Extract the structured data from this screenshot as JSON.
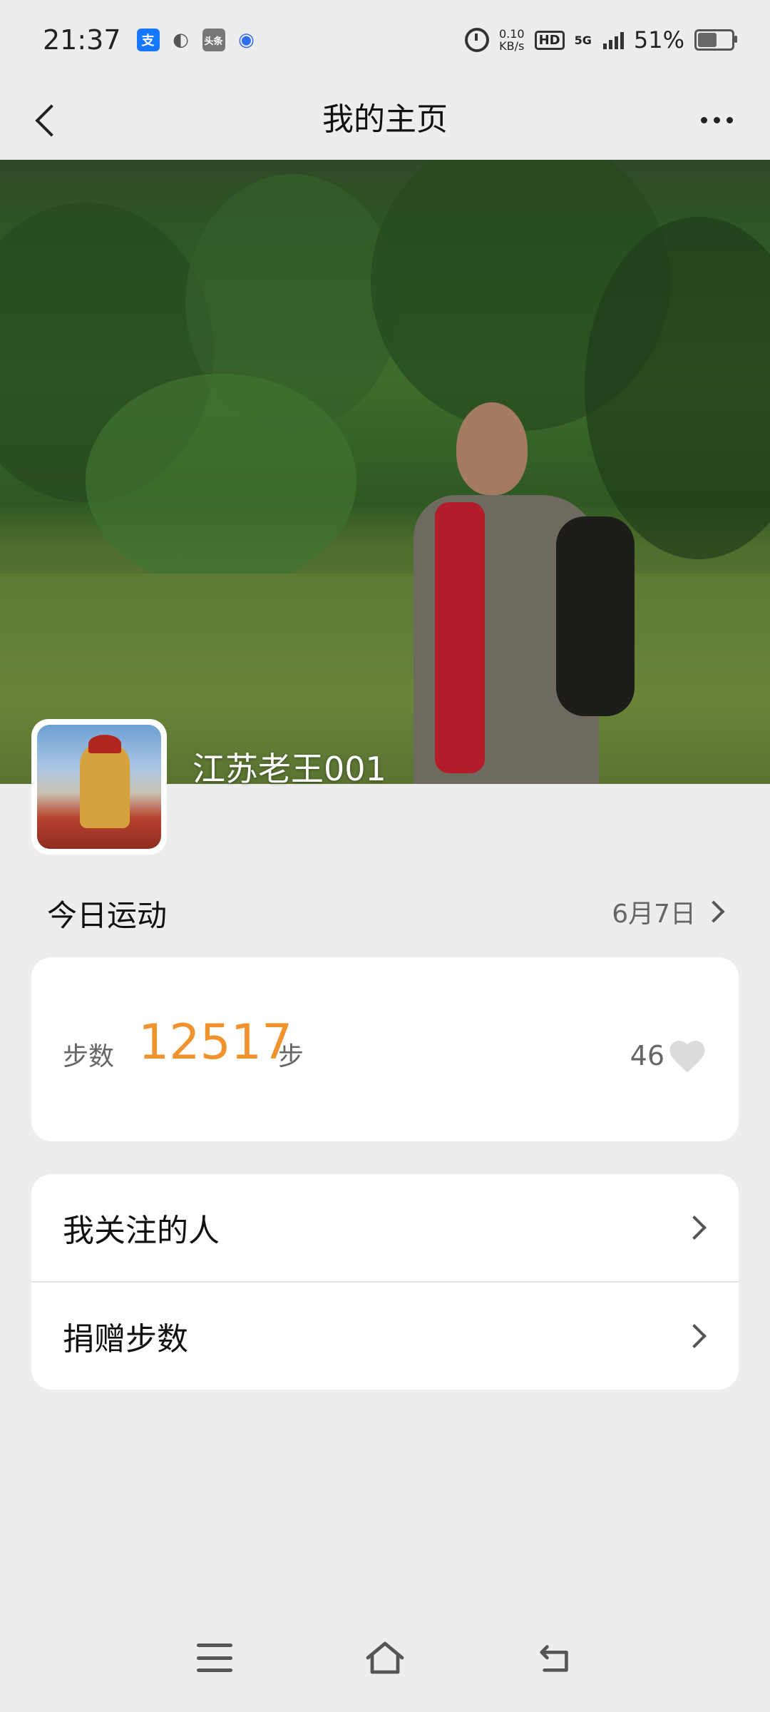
{
  "status_bar": {
    "time": "21:37",
    "app_icons": [
      {
        "icon": "alipay-icon",
        "glyph": "支",
        "color": "#1677ff"
      },
      {
        "icon": "app-swirl-icon",
        "glyph": "◐",
        "color": "#555555"
      },
      {
        "icon": "toutiao-icon",
        "glyph": "头条",
        "color": "#555555"
      },
      {
        "icon": "baidu-icon",
        "glyph": "◉",
        "color": "#2f6cf0"
      }
    ],
    "net_speed_value": "0.10",
    "net_speed_unit": "KB/s",
    "hd": "HD",
    "network": "5G",
    "battery": "51%",
    "battery_level": 0.51
  },
  "nav": {
    "title": "我的主页"
  },
  "profile": {
    "username": "江苏老王001"
  },
  "today": {
    "title": "今日运动",
    "date": "6月7日"
  },
  "steps_card": {
    "label": "步数",
    "value": "12517",
    "unit": "步",
    "likes": "46"
  },
  "menu": {
    "items": [
      {
        "label": "我关注的人"
      },
      {
        "label": "捐赠步数"
      }
    ]
  },
  "colors": {
    "accent_orange": "#f0922d",
    "background": "#ededed"
  }
}
